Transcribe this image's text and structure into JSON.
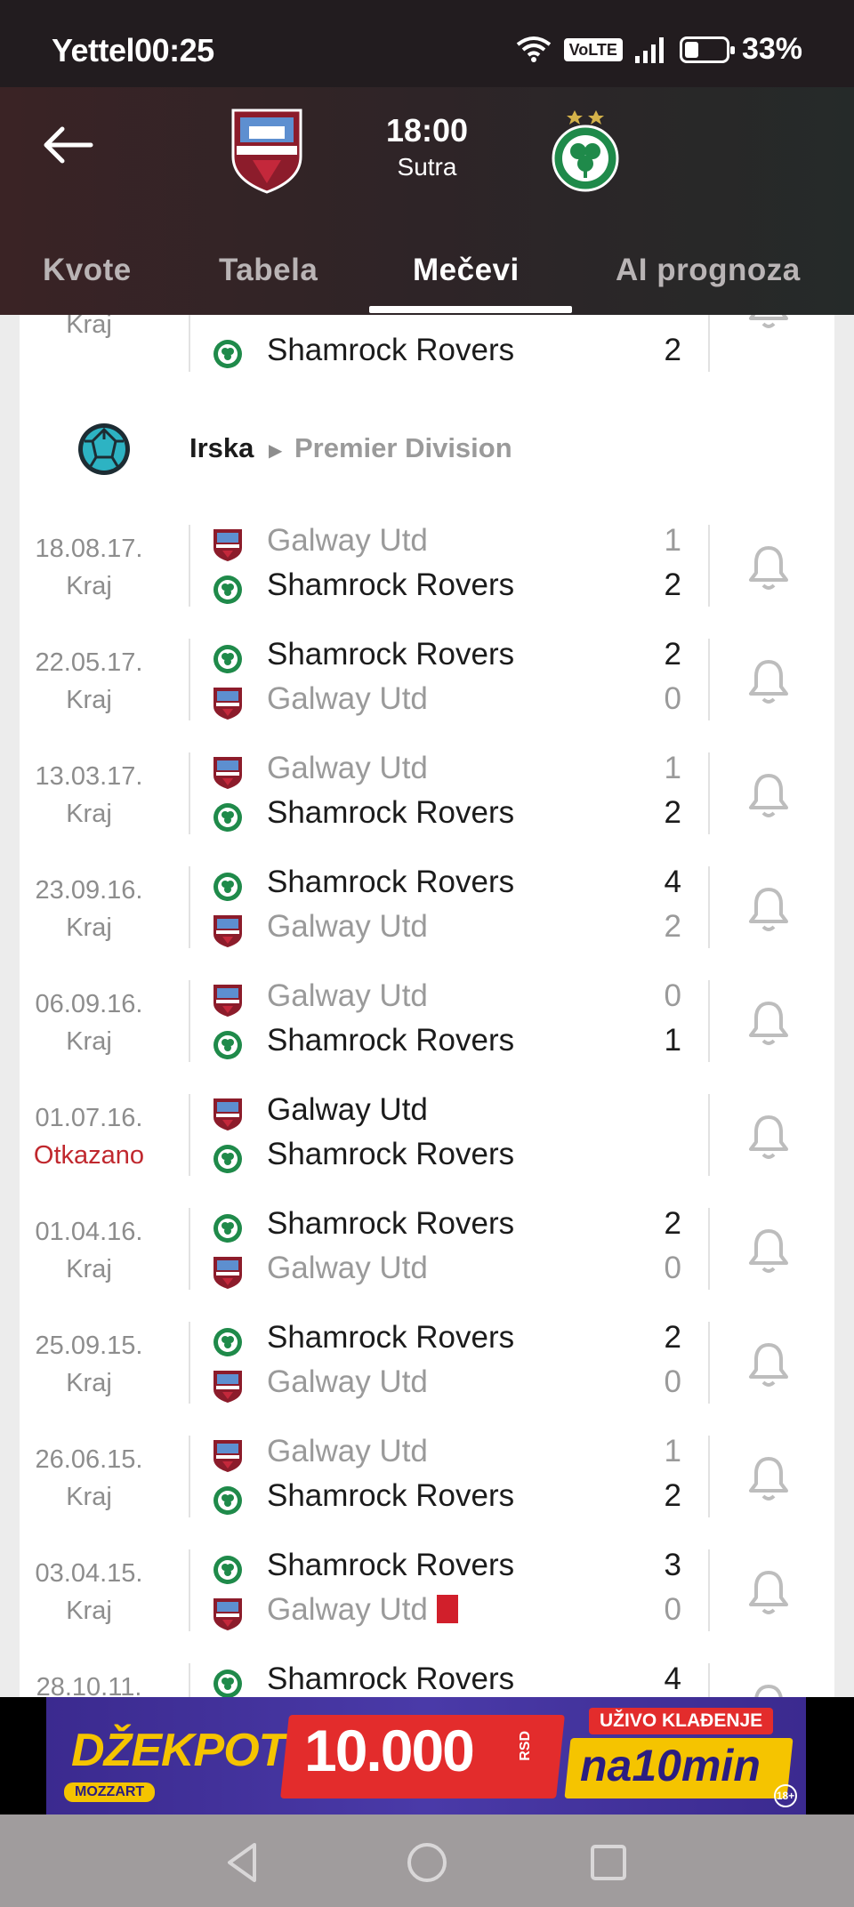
{
  "status": {
    "carrier": "Yettel",
    "time": "00:25",
    "volte": "VoLTE",
    "battery_percent": "33%",
    "battery_level": 0.33
  },
  "header": {
    "kickoff_time": "18:00",
    "kickoff_day": "Sutra",
    "home_team": "Galway United",
    "away_team": "Shamrock Rovers"
  },
  "tabs": [
    {
      "label": "Kvote",
      "active": false
    },
    {
      "label": "Tabela",
      "active": false
    },
    {
      "label": "Mečevi",
      "active": true
    },
    {
      "label": "AI prognoza",
      "active": false
    }
  ],
  "league": {
    "country": "Irska",
    "competition": "Premier Division"
  },
  "partial_top": {
    "state": "Kraj",
    "team": "Shamrock Rovers",
    "score": "2"
  },
  "matches": [
    {
      "date": "18.08.17.",
      "state": "Kraj",
      "team1": "Galway Utd",
      "score1": "1",
      "team2": "Shamrock Rovers",
      "score2": "2"
    },
    {
      "date": "22.05.17.",
      "state": "Kraj",
      "team1": "Shamrock Rovers",
      "score1": "2",
      "team2": "Galway Utd",
      "score2": "0"
    },
    {
      "date": "13.03.17.",
      "state": "Kraj",
      "team1": "Galway Utd",
      "score1": "1",
      "team2": "Shamrock Rovers",
      "score2": "2"
    },
    {
      "date": "23.09.16.",
      "state": "Kraj",
      "team1": "Shamrock Rovers",
      "score1": "4",
      "team2": "Galway Utd",
      "score2": "2"
    },
    {
      "date": "06.09.16.",
      "state": "Kraj",
      "team1": "Galway Utd",
      "score1": "0",
      "team2": "Shamrock Rovers",
      "score2": "1"
    },
    {
      "date": "01.07.16.",
      "state": "Otkazano",
      "team1": "Galway Utd",
      "score1": "",
      "team2": "Shamrock Rovers",
      "score2": ""
    },
    {
      "date": "01.04.16.",
      "state": "Kraj",
      "team1": "Shamrock Rovers",
      "score1": "2",
      "team2": "Galway Utd",
      "score2": "0"
    },
    {
      "date": "25.09.15.",
      "state": "Kraj",
      "team1": "Shamrock Rovers",
      "score1": "2",
      "team2": "Galway Utd",
      "score2": "0"
    },
    {
      "date": "26.06.15.",
      "state": "Kraj",
      "team1": "Galway Utd",
      "score1": "1",
      "team2": "Shamrock Rovers",
      "score2": "2"
    },
    {
      "date": "03.04.15.",
      "state": "Kraj",
      "team1": "Shamrock Rovers",
      "score1": "3",
      "team2": "Galway Utd",
      "score2": "0"
    },
    {
      "date": "28.10.11.",
      "state": "",
      "team1": "Shamrock Rovers",
      "score1": "4",
      "team2": "",
      "score2": ""
    }
  ],
  "ad": {
    "headline": "DŽEKPOT",
    "amount": "10.000",
    "currency": "RSD",
    "live_badge": "UŽIVO KLAĐENJE",
    "duration": "na10min",
    "brand": "MOZZART",
    "age": "18+"
  },
  "colors": {
    "header_bg": "#2e2427",
    "cancel": "#c0282e",
    "red_card": "#d11f2b"
  }
}
